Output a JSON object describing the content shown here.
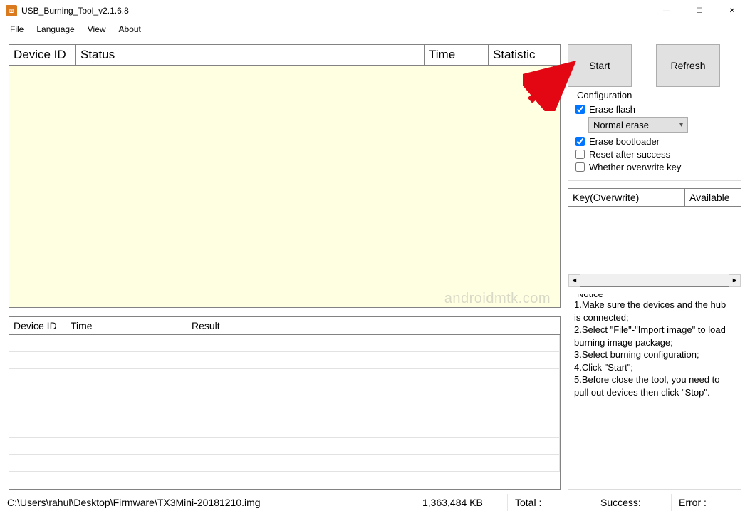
{
  "window": {
    "title": "USB_Burning_Tool_v2.1.6.8"
  },
  "menu": {
    "file": "File",
    "language": "Language",
    "view": "View",
    "about": "About"
  },
  "main_table": {
    "headers": {
      "device_id": "Device ID",
      "status": "Status",
      "time": "Time",
      "statistic": "Statistic"
    }
  },
  "result_table": {
    "headers": {
      "device_id": "Device ID",
      "time": "Time",
      "result": "Result"
    }
  },
  "buttons": {
    "start": "Start",
    "refresh": "Refresh"
  },
  "config": {
    "legend": "Configuration",
    "erase_flash_label": "Erase flash",
    "erase_flash_checked": true,
    "erase_mode": "Normal erase",
    "erase_bootloader_label": "Erase bootloader",
    "erase_bootloader_checked": true,
    "reset_label": "Reset after success",
    "reset_checked": false,
    "overwrite_label": "Whether overwrite key",
    "overwrite_checked": false
  },
  "key_table": {
    "headers": {
      "key": "Key(Overwrite)",
      "available": "Available"
    }
  },
  "notice": {
    "legend": "Notice",
    "line1": "1.Make sure the devices and the hub is connected;",
    "line2": "2.Select \"File\"-\"Import image\" to load burning image package;",
    "line3": "3.Select burning configuration;",
    "line4": "4.Click \"Start\";",
    "line5": "5.Before close the tool, you need to pull out devices then click \"Stop\"."
  },
  "statusbar": {
    "path": "C:\\Users\\rahul\\Desktop\\Firmware\\TX3Mini-20181210.img",
    "size": "1,363,484 KB",
    "total_label": "Total :",
    "success_label": "Success:",
    "error_label": "Error :"
  },
  "watermark": "androidmtk.com"
}
